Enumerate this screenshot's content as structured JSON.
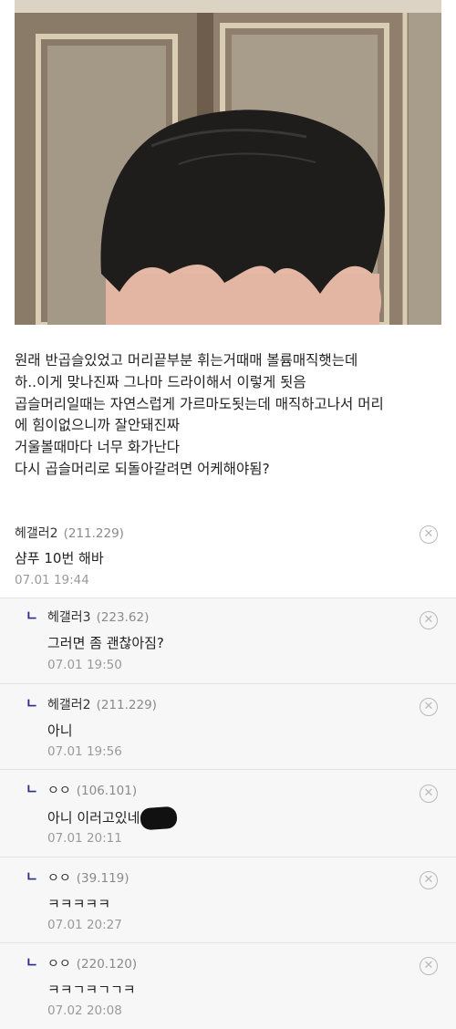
{
  "post": {
    "lines": [
      "원래 반곱슬있었고 머리끝부분 휘는거때매 볼륨매직햇는데",
      "하..이게 맞나진짜 그나마 드라이해서 이렇게 됫음",
      "곱슬머리일때는 자연스럽게 가르마도됫는데 매직하고나서 머리",
      "에 힘이없으니까 잘안돼진짜",
      "거울볼때마다 너무 화가난다",
      "다시 곱슬머리로 되돌아갈려면 어케해야됨?"
    ]
  },
  "comments": [
    {
      "author": "헤갤러2",
      "ip": "(211.229)",
      "text": "샴푸 10번 해바",
      "time": "07.01 19:44",
      "reply": false
    },
    {
      "author": "헤갤러3",
      "ip": "(223.62)",
      "text": "그러면 좀 괜찮아짐?",
      "time": "07.01 19:50",
      "reply": true,
      "mark": "ㄴ"
    },
    {
      "author": "헤갤러2",
      "ip": "(211.229)",
      "text": "아니",
      "time": "07.01 19:56",
      "reply": true,
      "mark": "ㄴ"
    },
    {
      "author": "ㅇㅇ",
      "ip": "(106.101)",
      "text": "아니 이러고있네",
      "time": "07.01 20:11",
      "reply": true,
      "mark": "ㄴ"
    },
    {
      "author": "ㅇㅇ",
      "ip": "(39.119)",
      "text": "ㅋㅋㅋㅋㅋ",
      "time": "07.01 20:27",
      "reply": true,
      "mark": "ㄴ"
    },
    {
      "author": "ㅇㅇ",
      "ip": "(220.120)",
      "text": "ㅋㅋㄱㅋㄱㄱㅋ",
      "time": "07.02 20:08",
      "reply": true,
      "mark": "ㄴ"
    }
  ],
  "ui": {
    "close_glyph": "✕"
  },
  "icons": {
    "delete": "close-circle-icon",
    "reply": "reply-arrow-icon"
  }
}
